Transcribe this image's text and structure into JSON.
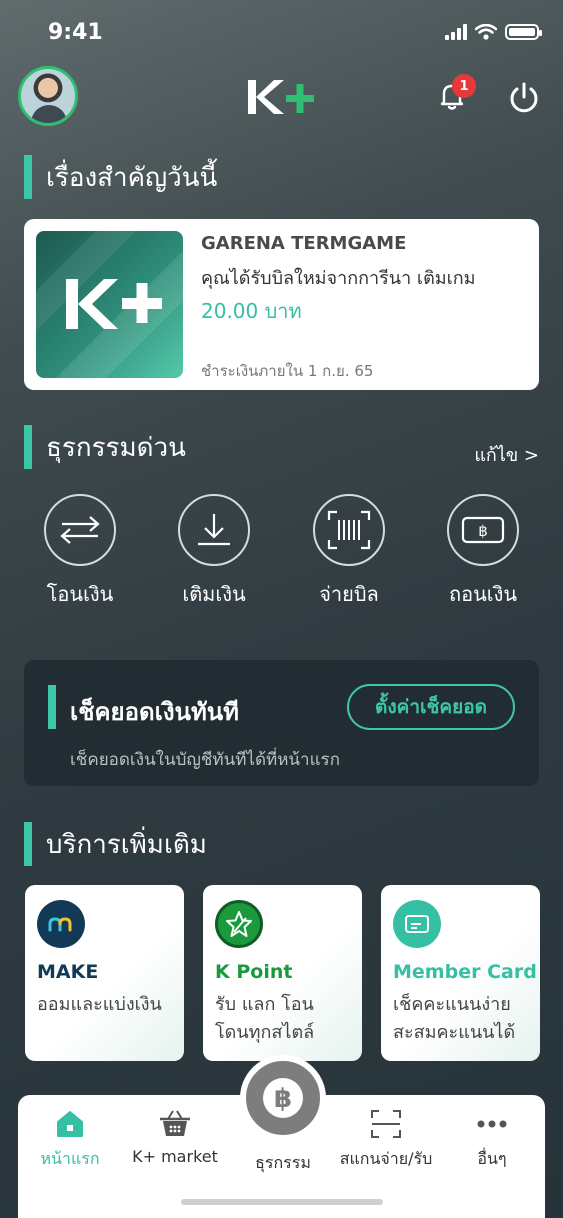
{
  "status_bar": {
    "time": "9:41"
  },
  "header": {
    "logo_text": "K+",
    "notification_count": "1"
  },
  "important_today": {
    "title": "เรื่องสำคัญวันนี้",
    "card": {
      "biller": "GARENA TERMGAME",
      "description": "คุณได้รับบิลใหม่จากการีนา เติมเกม",
      "amount": "20.00 บาท",
      "due": "ชำระเงินภายใน 1 ก.ย. 65"
    }
  },
  "quick_transactions": {
    "title": "ธุรกรรมด่วน",
    "edit_label": "แก้ไข >",
    "items": [
      {
        "label": "โอนเงิน",
        "icon": "transfer-icon"
      },
      {
        "label": "เติมเงิน",
        "icon": "topup-icon"
      },
      {
        "label": "จ่ายบิล",
        "icon": "barcode-scan-icon"
      },
      {
        "label": "ถอนเงิน",
        "icon": "withdraw-icon"
      }
    ]
  },
  "balance_check": {
    "title": "เช็คยอดเงินทันที",
    "button_label": "ตั้งค่าเช็คยอด",
    "description": "เช็คยอดเงินในบัญชีทันทีได้ที่หน้าแรก"
  },
  "more_services": {
    "title": "บริการเพิ่มเติม",
    "items": [
      {
        "name": "MAKE",
        "desc_line1": "ออมและแบ่งเงิน",
        "desc_line2": "",
        "name_color": "#123a57"
      },
      {
        "name": "K Point",
        "desc_line1": "รับ แลก โอน",
        "desc_line2": "โดนทุกสไตล์",
        "name_color": "#1a9a3d"
      },
      {
        "name": "Member Card",
        "desc_line1": "เช็คคะแนนง่าย",
        "desc_line2": "สะสมคะแนนได้",
        "name_color": "#35bfa3"
      }
    ]
  },
  "bottom_nav": {
    "items": [
      {
        "label": "หน้าแรก",
        "icon": "home-icon",
        "active": true
      },
      {
        "label": "K+ market",
        "icon": "basket-icon"
      },
      {
        "label": "ธุรกรรม",
        "icon": "baht-icon"
      },
      {
        "label": "สแกนจ่าย/รับ",
        "icon": "scan-icon"
      },
      {
        "label": "อื่นๆ",
        "icon": "more-icon"
      }
    ]
  },
  "colors": {
    "accent": "#3ec6a8",
    "brand_green": "#2fbf71",
    "badge": "#e8393a"
  }
}
